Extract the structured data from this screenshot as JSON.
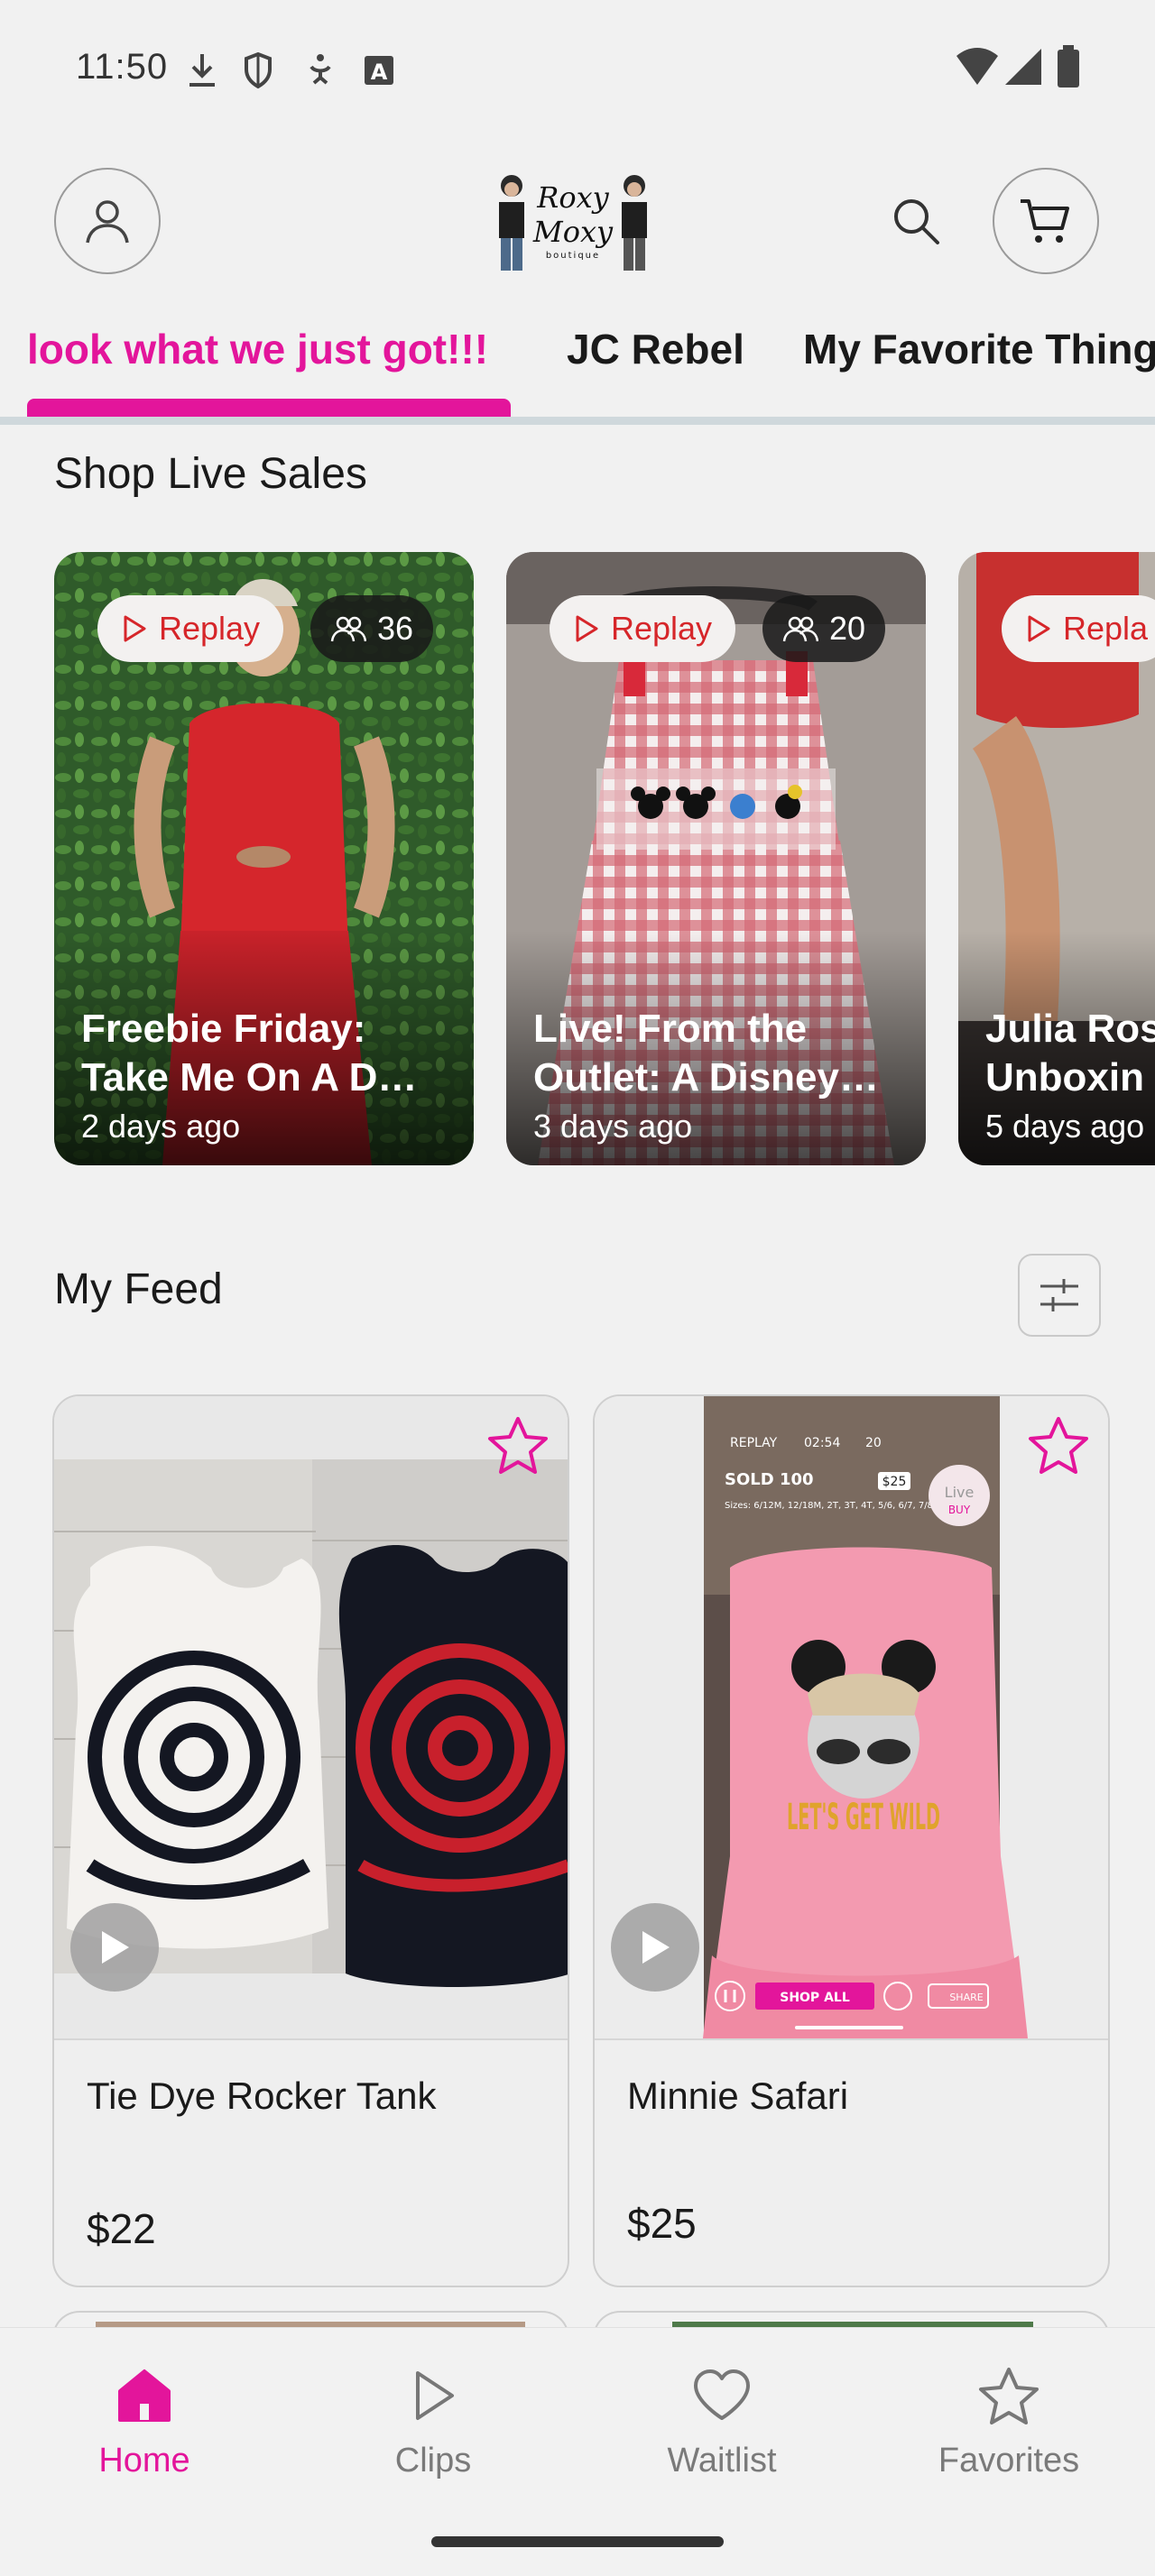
{
  "status_bar": {
    "time": "11:50"
  },
  "header": {
    "logo_text_line1": "Roxy",
    "logo_text_line2": "Moxy",
    "logo_text_line3": "boutique"
  },
  "tabs": [
    {
      "label": "look what we just got!!!",
      "active": true
    },
    {
      "label": "JC Rebel",
      "active": false
    },
    {
      "label": "My Favorite Thing",
      "active": false
    }
  ],
  "live_sales": {
    "title": "Shop Live Sales",
    "cards": [
      {
        "replay_label": "Replay",
        "viewers": "36",
        "title_line1": "Freebie Friday:",
        "title_line2": "Take Me On A D…",
        "time": "2 days ago"
      },
      {
        "replay_label": "Replay",
        "viewers": "20",
        "title_line1": "Live!  From the",
        "title_line2": "Outlet: A Disney…",
        "time": "3 days ago"
      },
      {
        "replay_label": "Repla",
        "viewers": "",
        "title_line1": "Julia Ros",
        "title_line2": "Unboxin",
        "time": "5 days ago"
      }
    ]
  },
  "feed": {
    "title": "My Feed",
    "items": [
      {
        "name": "Tie Dye Rocker Tank",
        "price": "$22",
        "favorited": false
      },
      {
        "name": "Minnie Safari",
        "price": "$25",
        "favorited": false,
        "overlay": {
          "replay": "REPLAY",
          "duration": "02:54",
          "views": "20",
          "sold": "SOLD 100",
          "price_tag": "$25",
          "sizes": "Sizes: 6/12M, 12/18M, 2T, 3T, 4T, 5/6, 6/7, 7/8",
          "live_label": "Live",
          "buy_label": "BUY",
          "shirt_text": "LET'S GET WILD",
          "shop_all": "SHOP ALL",
          "share": "SHARE"
        }
      }
    ]
  },
  "bottom_nav": [
    {
      "label": "Home",
      "icon": "home-icon",
      "active": true
    },
    {
      "label": "Clips",
      "icon": "play-outline-icon",
      "active": false
    },
    {
      "label": "Waitlist",
      "icon": "heart-icon",
      "active": false
    },
    {
      "label": "Favorites",
      "icon": "star-icon",
      "active": false
    }
  ],
  "colors": {
    "accent": "#e3159b",
    "replay_text": "#d6262a",
    "background": "#f1f1f1"
  }
}
